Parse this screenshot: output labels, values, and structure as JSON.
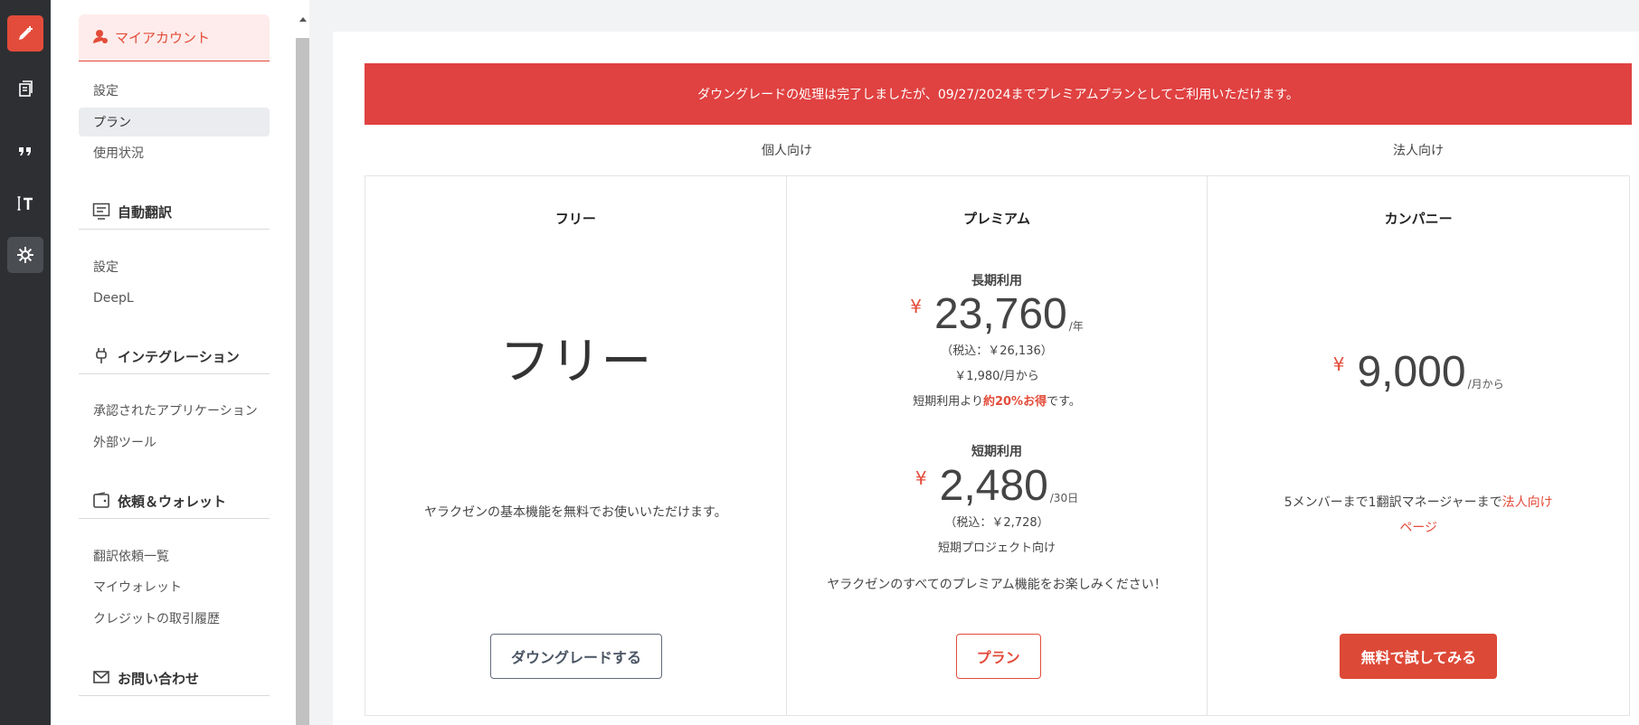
{
  "rail": {
    "items": [
      "pen-plus-icon",
      "documents-icon",
      "quote-icon",
      "text-format-icon",
      "gear-icon"
    ],
    "active": "gear-icon"
  },
  "menu": {
    "account": {
      "label": "マイアカウント",
      "icon": "user-icon"
    },
    "account_items": [
      "設定",
      "プラン",
      "使用状況"
    ],
    "active_item": "プラン",
    "auto_translate": {
      "label": "自動翻訳",
      "icon": "document-lines-icon",
      "items": [
        "設定",
        "DeepL"
      ]
    },
    "integration": {
      "label": "インテグレーション",
      "icon": "plug-icon",
      "items": [
        "承認されたアプリケーション",
        "外部ツール"
      ]
    },
    "wallet": {
      "label": "依頼＆ウォレット",
      "icon": "wallet-icon",
      "items": [
        "翻訳依頼一覧",
        "マイウォレット",
        "クレジットの取引履歴"
      ]
    },
    "contact": {
      "label": "お問い合わせ",
      "icon": "mail-icon"
    }
  },
  "alert": {
    "text": "ダウングレードの処理は完了しましたが、09/27/2024までプレミアムプランとしてご利用いただけます。"
  },
  "categories": {
    "personal": "個人向け",
    "business": "法人向け"
  },
  "plans": {
    "free": {
      "name": "フリー",
      "big": "フリー",
      "desc": "ヤラクゼンの基本機能を無料でお使いいただけます。",
      "button": "ダウングレードする"
    },
    "premium": {
      "name": "プレミアム",
      "long_label": "長期利用",
      "currency": "¥",
      "long_amount": "23,760",
      "long_unit": "/年",
      "long_tax": "（税込：￥26,136）",
      "long_monthly": "￥1,980/月から",
      "saving_pre": "短期利用より",
      "saving_red": "約20%お得",
      "saving_post": "です。",
      "short_label": "短期利用",
      "short_amount": "2,480",
      "short_unit": "/30日",
      "short_tax": "（税込：￥2,728）",
      "short_note": "短期プロジェクト向け",
      "desc": "ヤラクゼンのすべてのプレミアム機能をお楽しみください！",
      "button": "プラン"
    },
    "company": {
      "name": "カンパニー",
      "currency": "¥",
      "amount": "9,000",
      "unit": "/月から",
      "desc_pre": "5メンバーまで1翻訳マネージャーまで",
      "desc_link": "法人向け",
      "desc_link2": "ページ",
      "button": "無料で試してみる"
    }
  },
  "colors": {
    "accent": "#e34c3a",
    "alert_bg": "#e04141",
    "rail_bg": "#2d2f33"
  }
}
